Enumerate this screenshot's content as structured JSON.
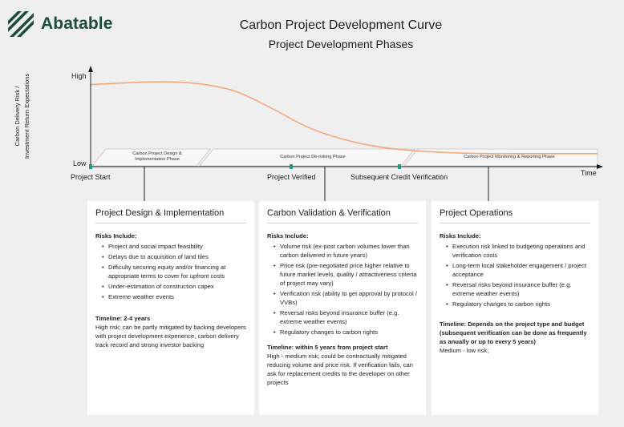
{
  "logo": {
    "text": "Abatable",
    "icon": "abatable-leaf-icon",
    "color": "#1b4c3d"
  },
  "title": "Carbon Project Development Curve",
  "subtitle": "Project Development Phases",
  "colors": {
    "curve": "#f4a77a",
    "marker": "#1f9a8a",
    "axis": "#1d1d1d",
    "panel": "#ffffff",
    "background": "#efefef"
  },
  "chart_data": {
    "type": "line",
    "ylabel_lines": [
      "Carbon Delivery Risk /",
      "Investment Return Expectations"
    ],
    "y_high_label": "High",
    "y_low_label": "Low",
    "x_end_label": "Time",
    "milestones": [
      {
        "label": "Project Start"
      },
      {
        "label": "Project Verified"
      },
      {
        "label": "Subsequent Credit Verification"
      }
    ],
    "phases": [
      {
        "lines": [
          "Carbon Project Design &",
          "Implementation Phase"
        ]
      },
      {
        "lines": [
          "Carbon Project De-risking Phase"
        ]
      },
      {
        "lines": [
          "Carbon Project Monitoring & Reporting Phase"
        ]
      }
    ],
    "curve_levels": [
      0.85,
      0.87,
      0.88,
      0.86,
      0.78,
      0.6,
      0.4,
      0.27,
      0.19,
      0.15,
      0.13,
      0.12,
      0.12,
      0.12,
      0.12
    ]
  },
  "panels": [
    {
      "heading": "Project Design & Implementation",
      "risks_title": "Risks Include:",
      "items": [
        "Project and social impact feasibility",
        "Delays due to acquisition of land tiles",
        "Difficulty securing equity and/or financing at appropriate terms to cover for upfront costs",
        "Under-estimation of construction capex",
        "Extreme weather events"
      ],
      "timeline": "Timeline: 2-4 years",
      "timeline_desc": "High risk; can be partly mitigated by backing developers with project development experience, carbon delivery track record and strong investor backing"
    },
    {
      "heading": "Carbon Validation & Verification",
      "risks_title": "Risks Include:",
      "items": [
        "Volume risk (ex-post carbon volumes lower than carbon delivered in future years)",
        "Price risk (pre-negotiated price higher relative to future market levels, quality / attractiveness criteria of project may vary)",
        "Verification risk (ability to get approval by protocol / VVBs)",
        "Reversal risks beyond insurance buffer (e.g. extreme weather events)",
        "Regulatory changes to carbon rights"
      ],
      "timeline": "Timeline: within 5 years from project start",
      "timeline_desc": "High - medium risk; could be contractually mitigated reducing volume and price risk. If verification fails, can ask for replacement credits to the developer on other projects"
    },
    {
      "heading": "Project Operations",
      "risks_title": "Risks Include:",
      "items": [
        "Execution risk linked to budgeting operations and verification costs",
        "Long-term local stakeholder engagement / project acceptance",
        "Reversal risks beyond insurance buffer (e.g. extreme weather events)",
        "Regulatory changes to carbon rights"
      ],
      "timeline": "Timeline: Depends on the project type and budget (subsequent verification can be done as frequently as anually or up to every 5 years)",
      "timeline_desc": "Medium - low risk;"
    }
  ]
}
